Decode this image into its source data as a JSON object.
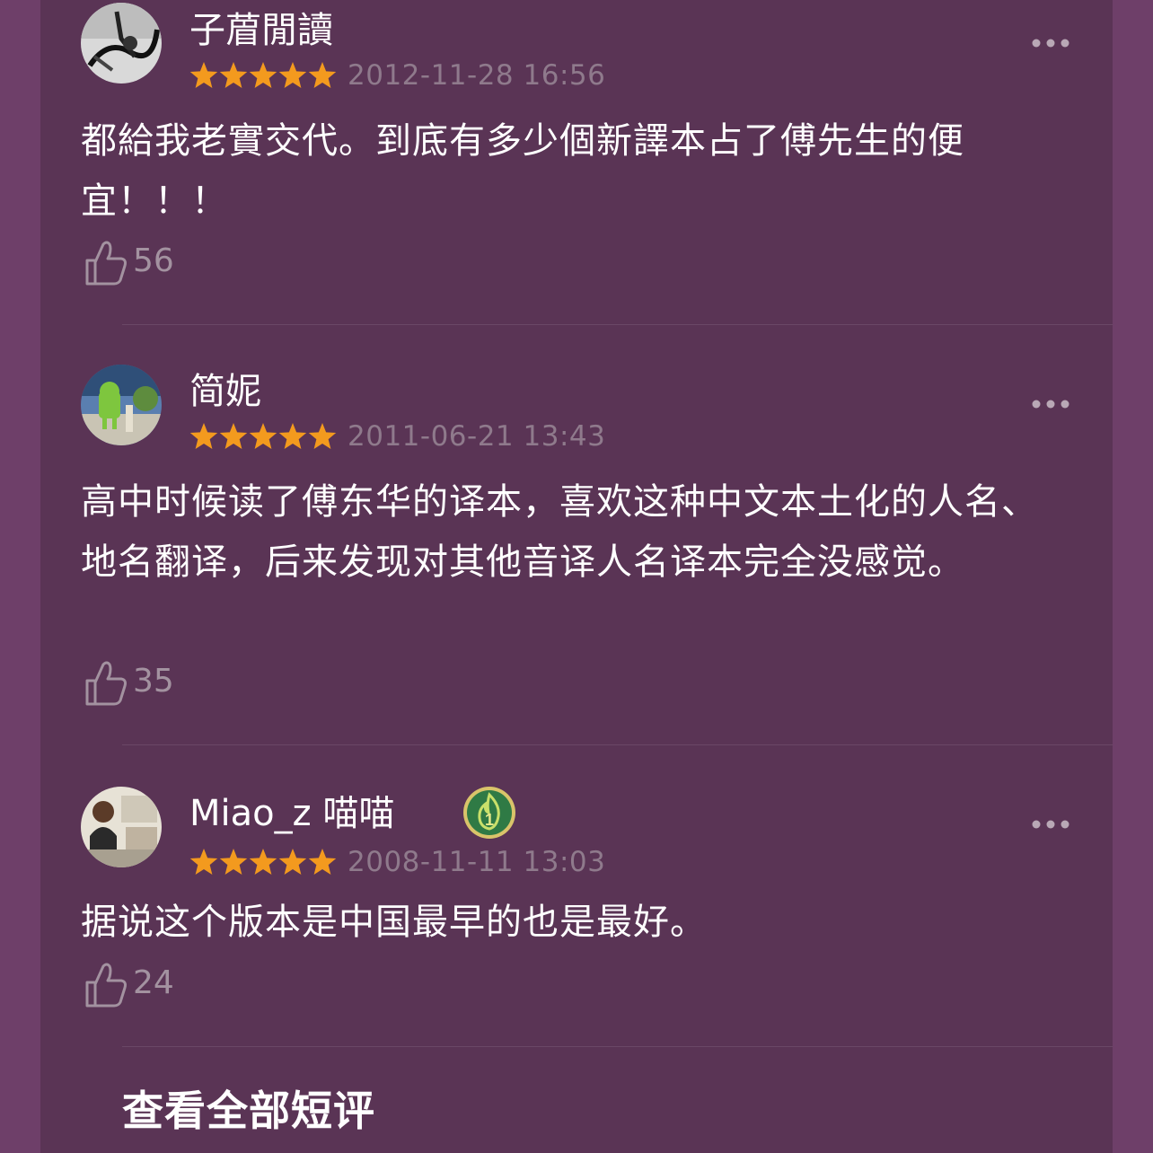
{
  "colors": {
    "background": "#6e3f69",
    "panel": "#5a3455",
    "star": "#f39a1e",
    "text": "#ffffff",
    "muted": "#8f7a8c"
  },
  "reviews": [
    {
      "username": "子葿閒讀",
      "rating": 5,
      "date": "2012-11-28 16:56",
      "content": "都給我老實交代。到底有多少個新譯本占了傅先生的便宜！！！",
      "likes": "56",
      "badge": null
    },
    {
      "username": "简妮",
      "rating": 5,
      "date": "2011-06-21 13:43",
      "content": "高中时候读了傅东华的译本，喜欢这种中文本土化的人名、地名翻译，后来发现对其他音译人名译本完全没感觉。",
      "likes": "35",
      "badge": null
    },
    {
      "username": "Miao_z 喵喵",
      "rating": 5,
      "date": "2008-11-11 13:03",
      "content": "据说这个版本是中国最早的也是最好。",
      "likes": "24",
      "badge": "1"
    }
  ],
  "icons": {
    "more": "more-icon",
    "like": "thumbs-up-icon",
    "star": "star-icon",
    "badge": "flame-badge-icon"
  },
  "footer": {
    "view_all_label": "查看全部短评"
  }
}
